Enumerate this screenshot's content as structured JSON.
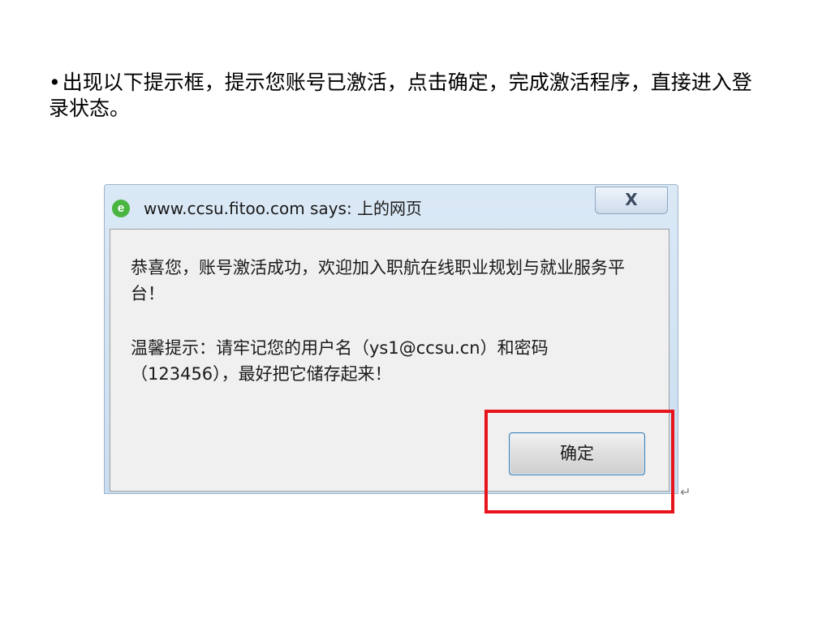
{
  "slide": {
    "bullet": "•",
    "instruction": "出现以下提示框，提示您账号已激活，点击确定，完成激活程序，直接进入登录状态。"
  },
  "dialog": {
    "title": "www.ccsu.fitoo.com says: 上的网页",
    "close_label": "X",
    "message_line1": "恭喜您，账号激活成功，欢迎加入职航在线职业规划与就业服务平台！",
    "message_line2": "温馨提示：请牢记您的用户名（ys1@ccsu.cn）和密码（123456），最好把它储存起来！",
    "ok_label": "确定"
  },
  "colors": {
    "highlight": "#e8141b",
    "ok_border": "#3c7fb1",
    "ie_icon": "#4bb542"
  },
  "icons": {
    "browser": "ie-icon",
    "close": "close-icon",
    "return": "paragraph-return-icon"
  },
  "misc": {
    "return_mark": "↵"
  }
}
